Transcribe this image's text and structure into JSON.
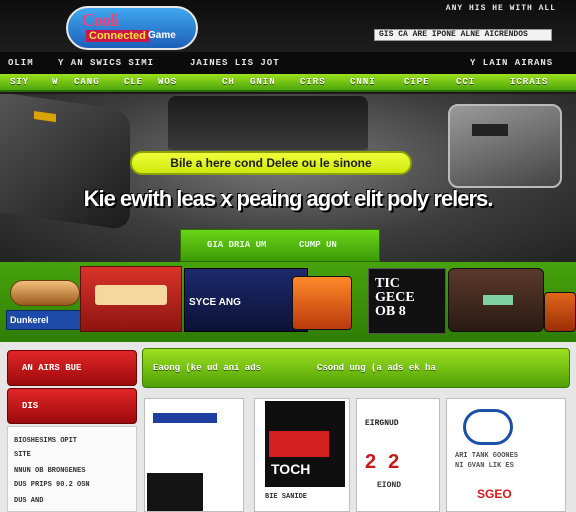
{
  "header": {
    "logo_line1": "Cooli",
    "logo_line2": "Connected",
    "logo_line3": "Game",
    "top_links": "ANY HIS  HE WITH ALL",
    "search_text": "GIS CA ARE IPONE ALNE AICRENDOS"
  },
  "subnav": {
    "items": [
      "OLIM",
      "Y AN SWICS SIMI",
      "JAINES  LIS JOT",
      "Y LAIN AIRANS"
    ]
  },
  "greennav": {
    "items": [
      "SIY",
      "W",
      "CANG",
      "CLE",
      "WOS",
      "CH",
      "GNIN",
      "CIRS",
      "CNNI",
      "CIPE",
      "CCI",
      "ICRAIS"
    ]
  },
  "hero": {
    "pill": "Bile a here cond Delee ou le sinone",
    "headline": "Kie ewith leas x peaing agot elit poly relers.",
    "cta_left": "GIA DRIA UM",
    "cta_right": "CUMP UN"
  },
  "products": {
    "p1b_label": "Dunkerel",
    "p3_label": "SYCE ANG",
    "p4_label": "TIC\nGECE\nOB 8"
  },
  "sidebar": {
    "btn1": "AN AIRS BUE",
    "btn2": "DIS",
    "lines": [
      "BIOSHESIMS OPIT",
      "SITE",
      "NNUN OB BRONGENES",
      "DUS PRIPS 90.2 OSN",
      "DUS AND"
    ]
  },
  "tabs": {
    "left": "Eaong (ke ud ani ads",
    "right": "Csond ung (a ads ek ha"
  },
  "cards": {
    "c2_caption": "BIE SANIDE",
    "c3_title": "EIRGNUD",
    "c3_big": "22",
    "c3_sub": "EIOND",
    "c4_text": "ARI TANK GOONES\nNI GVAN LIK ES",
    "c4_price": "SGEO"
  }
}
